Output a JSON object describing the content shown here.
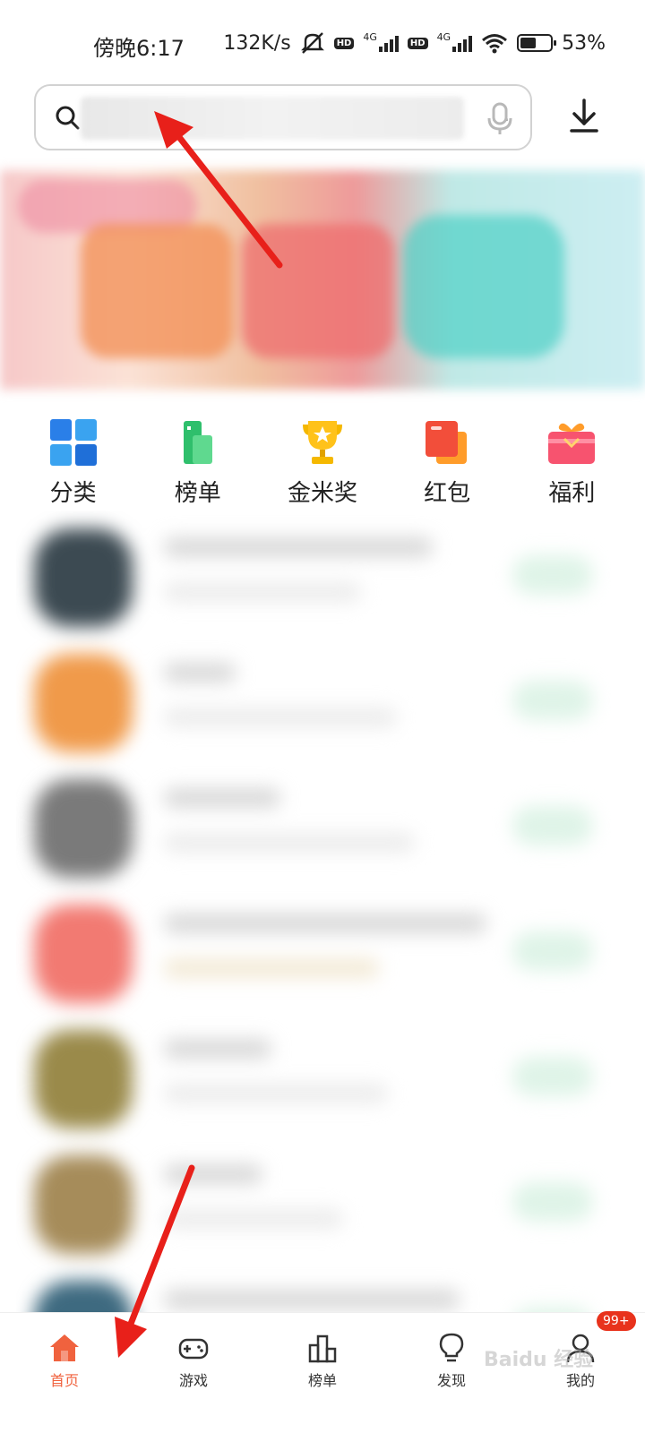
{
  "status_bar": {
    "time": "傍晚6:17",
    "net_speed": "132K/s",
    "hd": "HD",
    "network": "4G",
    "battery_percent": "53%",
    "battery_level": 0.53
  },
  "search": {
    "dots": ". ."
  },
  "quick_nav": [
    {
      "label": "分类",
      "icon": "category-icon"
    },
    {
      "label": "榜单",
      "icon": "ranking-icon"
    },
    {
      "label": "金米奖",
      "icon": "trophy-icon"
    },
    {
      "label": "红包",
      "icon": "red-packet-icon"
    },
    {
      "label": "福利",
      "icon": "gift-icon"
    }
  ],
  "bottom_nav": {
    "home": "首页",
    "games": "游戏",
    "rank": "榜单",
    "discover": "发现",
    "mine": "我的",
    "mine_badge": "99+"
  },
  "watermark": "Baidu 经验",
  "colors": {
    "accent": "#f0623e",
    "badge": "#e8321c",
    "arrow": "#e8201a"
  }
}
